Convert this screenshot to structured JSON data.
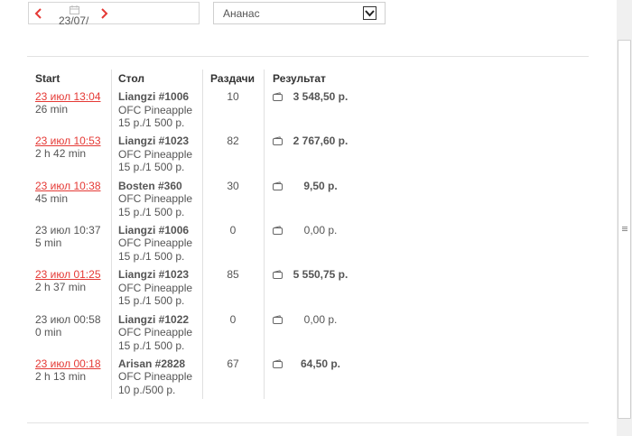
{
  "filters": {
    "date_value": "23/07/",
    "game_select": "Ананас"
  },
  "table": {
    "headers": {
      "start": "Start",
      "table": "Стол",
      "hands": "Раздачи",
      "result": "Результат"
    },
    "rows": [
      {
        "start": "23 июл 13:04",
        "start_link": true,
        "duration": "26 min",
        "table_name": "Liangzi #1006",
        "game": "OFC Pineapple",
        "stakes": "15 p./1 500 p.",
        "hands": "10",
        "result": "3 548,50 р.",
        "positive": true
      },
      {
        "start": "23 июл 10:53",
        "start_link": true,
        "duration": "2 h 42 min",
        "table_name": "Liangzi #1023",
        "game": "OFC Pineapple",
        "stakes": "15 p./1 500 p.",
        "hands": "82",
        "result": "2 767,60 р.",
        "positive": true
      },
      {
        "start": "23 июл 10:38",
        "start_link": true,
        "duration": "45 min",
        "table_name": "Bosten #360",
        "game": "OFC Pineapple",
        "stakes": "15 p./1 500 p.",
        "hands": "30",
        "result": "9,50 р.",
        "positive": true
      },
      {
        "start": "23 июл 10:37",
        "start_link": false,
        "duration": "5 min",
        "table_name": "Liangzi #1006",
        "game": "OFC Pineapple",
        "stakes": "15 p./1 500 p.",
        "hands": "0",
        "result": "0,00 р.",
        "positive": false
      },
      {
        "start": "23 июл 01:25",
        "start_link": true,
        "duration": "2 h 37 min",
        "table_name": "Liangzi #1023",
        "game": "OFC Pineapple",
        "stakes": "15 p./1 500 p.",
        "hands": "85",
        "result": "5 550,75 р.",
        "positive": true
      },
      {
        "start": "23 июл 00:58",
        "start_link": false,
        "duration": "0 min",
        "table_name": "Liangzi #1022",
        "game": "OFC Pineapple",
        "stakes": "15 p./1 500 p.",
        "hands": "0",
        "result": "0,00 р.",
        "positive": false
      },
      {
        "start": "23 июл 00:18",
        "start_link": true,
        "duration": "2 h 13 min",
        "table_name": "Arisan #2828",
        "game": "OFC Pineapple",
        "stakes": "10 p./500 p.",
        "hands": "67",
        "result": "64,50 р.",
        "positive": true
      }
    ]
  },
  "icons": {
    "prev": "chevron-left-icon",
    "next": "chevron-right-icon",
    "calendar": "calendar-icon",
    "dropdown": "chevron-down-icon",
    "wallet": "wallet-icon"
  },
  "colors": {
    "accent": "#e53935",
    "text": "#555555",
    "divider": "#e0e0e0"
  }
}
